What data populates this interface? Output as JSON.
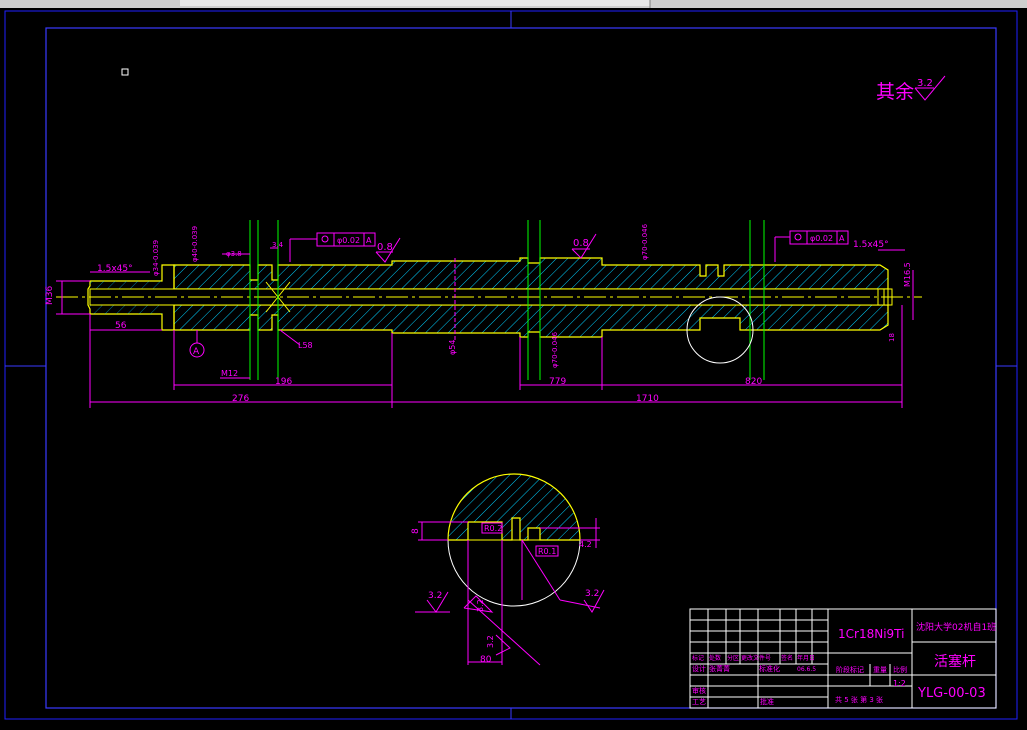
{
  "colors": {
    "background": "#000000",
    "frame": "#2020ff",
    "part_outline": "#ffff00",
    "hatch": "#00d0ff",
    "dimension": "#ff00ff",
    "centerline": "#00ff00",
    "title_block": "#ffffff"
  },
  "roughness_note": {
    "label": "其余",
    "value": "3.2"
  },
  "shaft": {
    "left_step_dia": "M36",
    "left_chamfer": "1.5x45°",
    "left_len": "56",
    "dia_labels": [
      "φ34-0.039",
      "φ40-0.039"
    ],
    "groove_w": "φ3.8",
    "groove_d": "3.4",
    "tol_frame_left": [
      "φ0.02",
      "A"
    ],
    "rough_left": "0.8",
    "rough_mid": "0.8",
    "dia_mid": "φ70-0.046",
    "tol_frame_right": [
      "φ0.02",
      "A"
    ],
    "right_chamfer": "1.5x45°",
    "right_thread": "M16.5",
    "datum": "A",
    "inner_bore": "L58",
    "dia_bottom": "φ54",
    "dia_bottom2": "φ70-0.046",
    "dim_12": "M12",
    "dim_196": "196",
    "dim_779": "779",
    "dim_820": "820",
    "dim_276": "276",
    "dim_1710": "1710",
    "right_small": "18"
  },
  "detail": {
    "depth_left": "8",
    "r1": "R0.2",
    "r2": "R0.1",
    "depth_right": "4.2",
    "rough_a": "3.2",
    "rough_b": "3.2",
    "rough_c": "3.2",
    "rough_d": "3.2",
    "width": "80"
  },
  "title_block": {
    "material": "1Cr18Ni9Ti",
    "school": "沈阳大学02机自1班",
    "part_name": "活塞杆",
    "drawing_no": "YLG-00-03",
    "scale": "1:2",
    "sheet": "共 5 张  第 3 张",
    "row_headers": [
      "标记",
      "处数",
      "分区",
      "更改文件号",
      "签名",
      "年月日"
    ],
    "design": "设计",
    "designer": "张菁菁",
    "standard": "标准化",
    "date": "06.6.5",
    "stage_mark": "阶段标记",
    "weight": "重量",
    "ratio": "比例",
    "review": "审核",
    "process": "工艺",
    "approve": "批准"
  }
}
